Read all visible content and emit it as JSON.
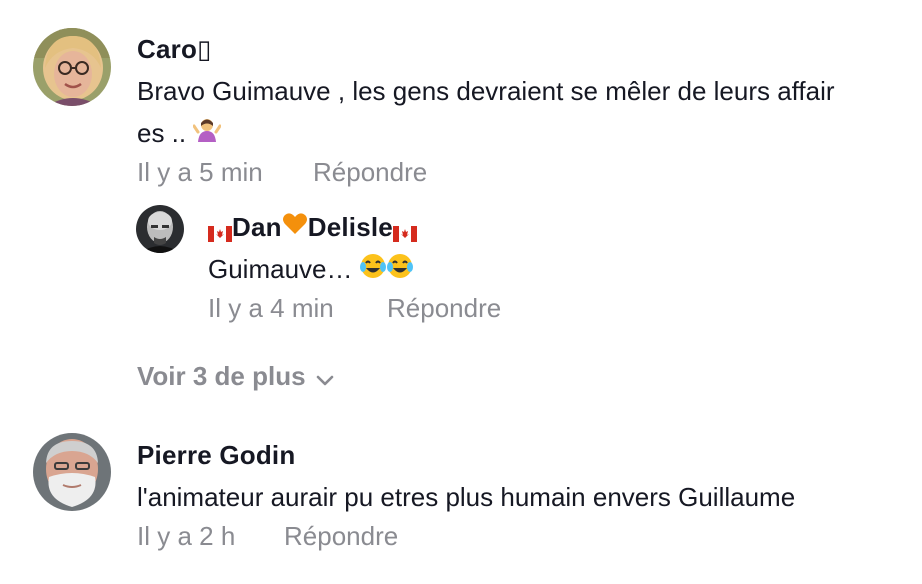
{
  "comments": [
    {
      "username": "Caro",
      "username_glyph": "▯",
      "text_line1": "Bravo Guimauve , les gens devraient se mêler de leurs affair",
      "text_line2": "es .. ",
      "text_emoji": "person-shrugging-emoji",
      "time": "Il y a 5 min",
      "reply_label": "Répondre",
      "avatar": "woman-with-glasses-avatar"
    },
    {
      "username_part1": "Dan",
      "username_part2": "Delisle",
      "username_flag": "canada-flag-emoji",
      "username_heart": "orange-heart-emoji",
      "text": "Guimauve… ",
      "text_emoji": "face-with-tears-of-joy-emoji",
      "time": "Il y a 4 min",
      "reply_label": "Répondre",
      "avatar": "bald-man-avatar"
    },
    {
      "username": "Pierre Godin",
      "text": "l'animateur aurair pu etres plus humain envers Guillaume",
      "time": "Il y a 2 h",
      "reply_label": "Répondre",
      "avatar": "bearded-man-avatar"
    }
  ],
  "view_more_label": "Voir 3 de plus",
  "colors": {
    "text": "#161823",
    "meta": "#8a8b91",
    "flag_red": "#d52b1e",
    "heart": "#f4900c"
  }
}
